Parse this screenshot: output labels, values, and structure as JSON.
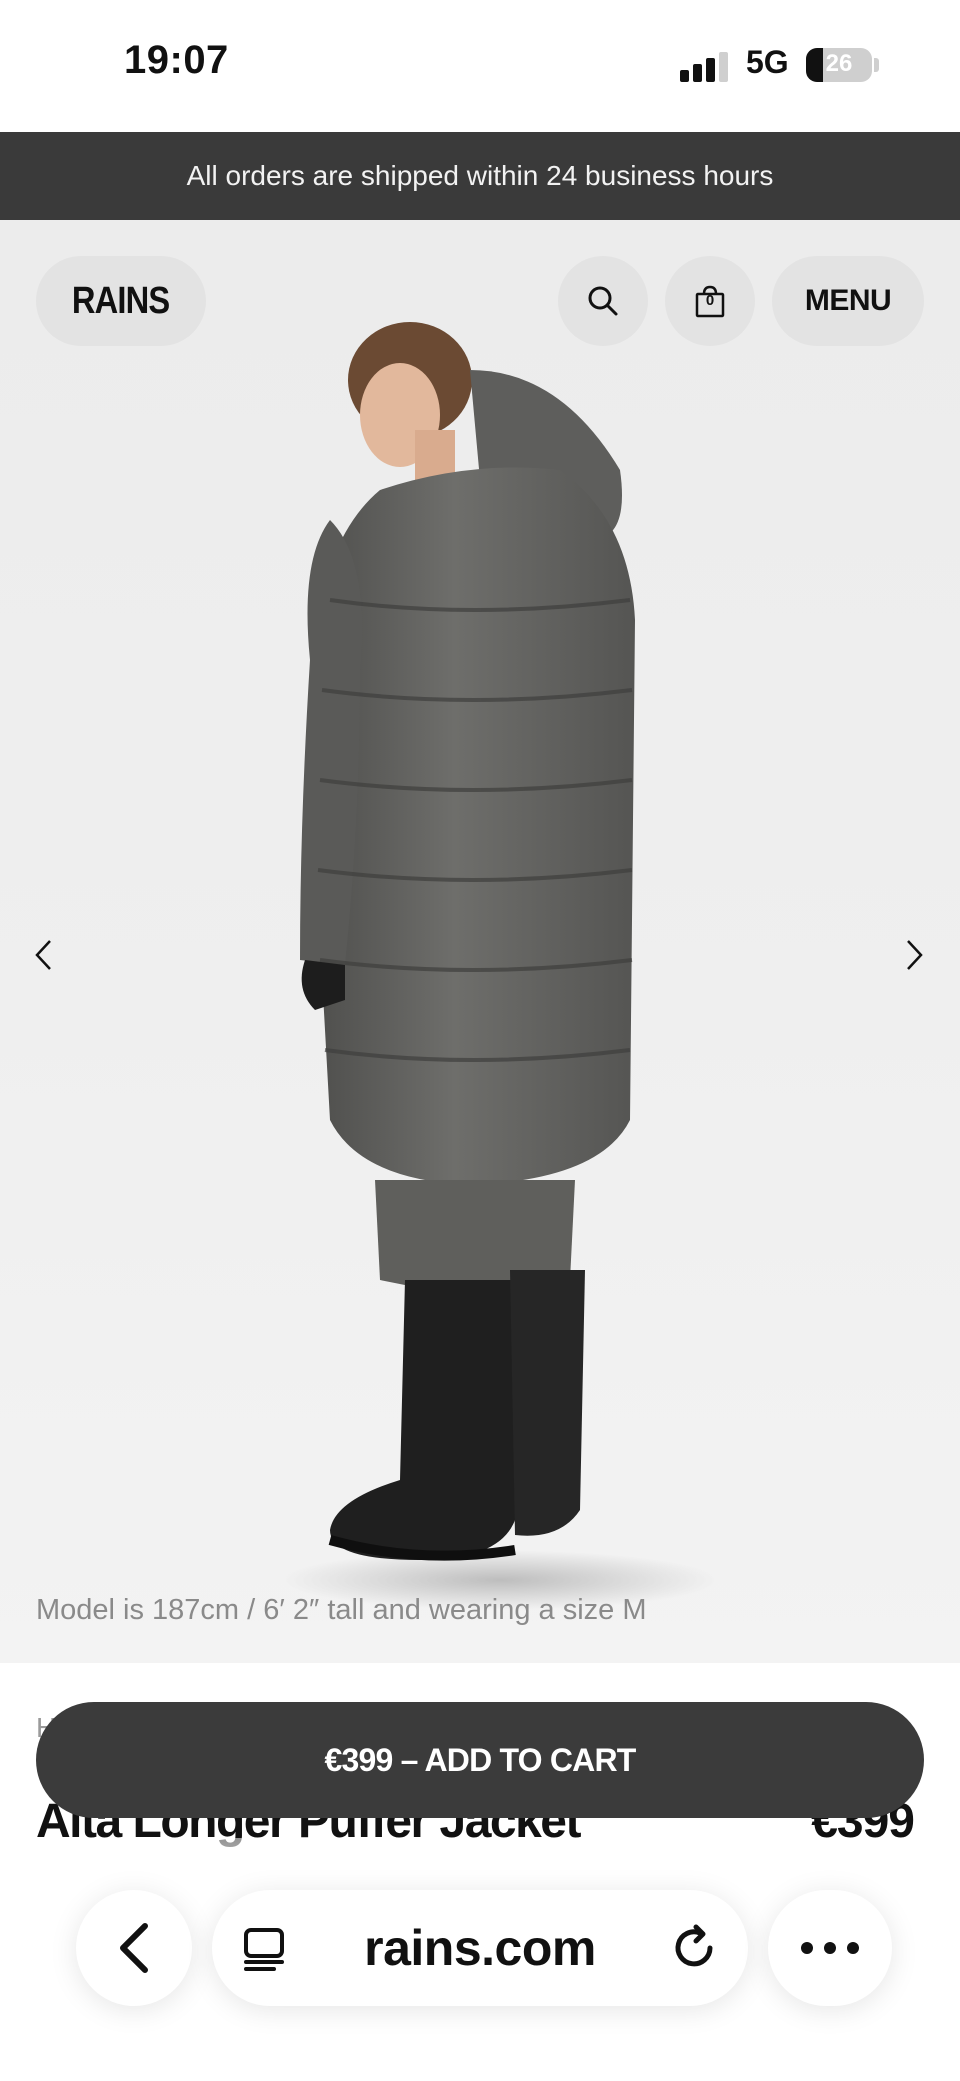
{
  "status_bar": {
    "time": "19:07",
    "network": "5G",
    "battery": "26"
  },
  "announcement": "All orders are shipped within 24 business hours",
  "header": {
    "logo": "RAINS",
    "menu_label": "MENU",
    "cart_count": "0",
    "search_icon": "search-icon",
    "bag_icon": "bag-icon"
  },
  "hero": {
    "model_note": "Model is 187cm / 6′ 2″ tall and wearing a size M",
    "prev_icon": "chevron-left-icon",
    "next_icon": "chevron-right-icon"
  },
  "product": {
    "breadcrumb": "H",
    "name": "Alta Longer Puffer Jacket",
    "price": "€399"
  },
  "cta": {
    "add_to_cart": "€399 – ADD TO CART"
  },
  "browser": {
    "url": "rains.com",
    "back_icon": "back-icon",
    "tabs_icon": "tabs-icon",
    "reload_icon": "reload-icon",
    "more_icon": "more-icon"
  },
  "colors": {
    "announcement_bg": "#3a3a3a",
    "cart_button_bg": "#3b3b3b",
    "hero_bg": "#ececec",
    "pill_bg": "#e3e3e3"
  }
}
